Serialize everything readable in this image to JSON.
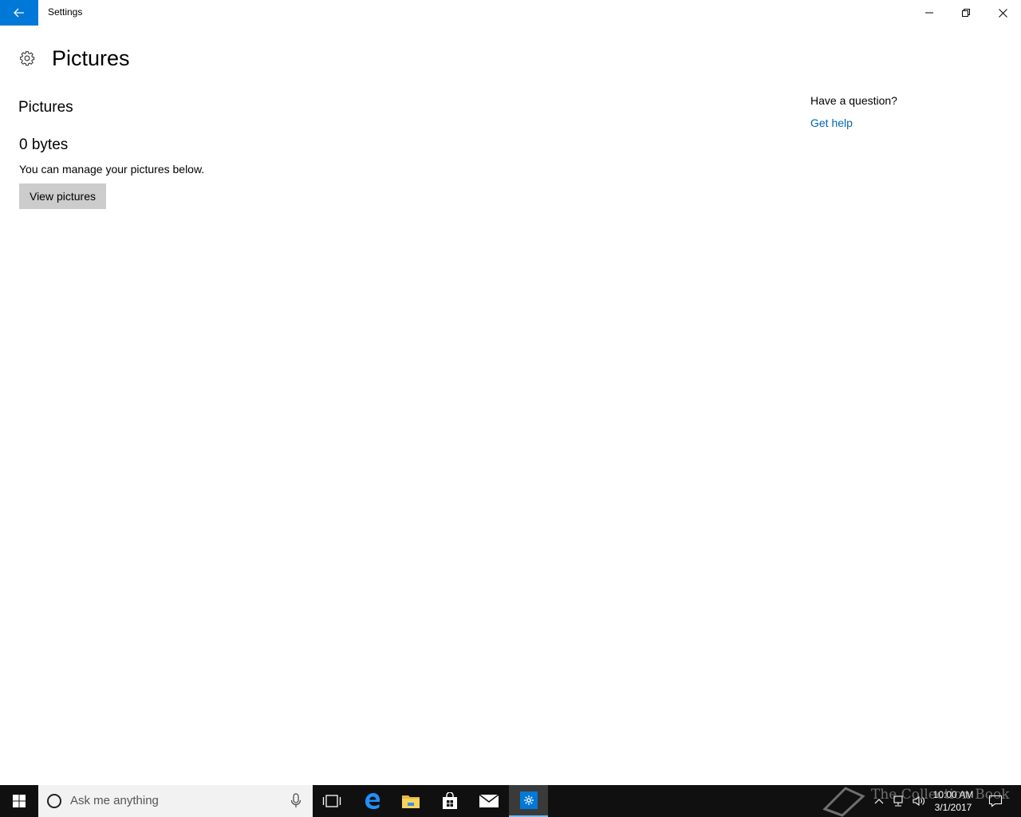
{
  "window": {
    "title": "Settings",
    "back_icon": "arrow-left-icon",
    "accent_color": "#0078d7"
  },
  "header": {
    "title": "Pictures",
    "icon": "gear-icon"
  },
  "content": {
    "section_title": "Pictures",
    "size_value": "0 bytes",
    "description": "You can manage your pictures below.",
    "view_button_label": "View pictures"
  },
  "help": {
    "question": "Have a question?",
    "link_label": "Get help",
    "link_color": "#0063b1"
  },
  "taskbar": {
    "search_placeholder": "Ask me anything",
    "clock_time": "10:00 AM",
    "clock_date": "3/1/2017",
    "pinned": [
      "task-view-icon",
      "edge-icon",
      "file-explorer-icon",
      "store-icon",
      "mail-icon",
      "settings-icon"
    ]
  },
  "watermark": {
    "text": "The Collection Book"
  }
}
